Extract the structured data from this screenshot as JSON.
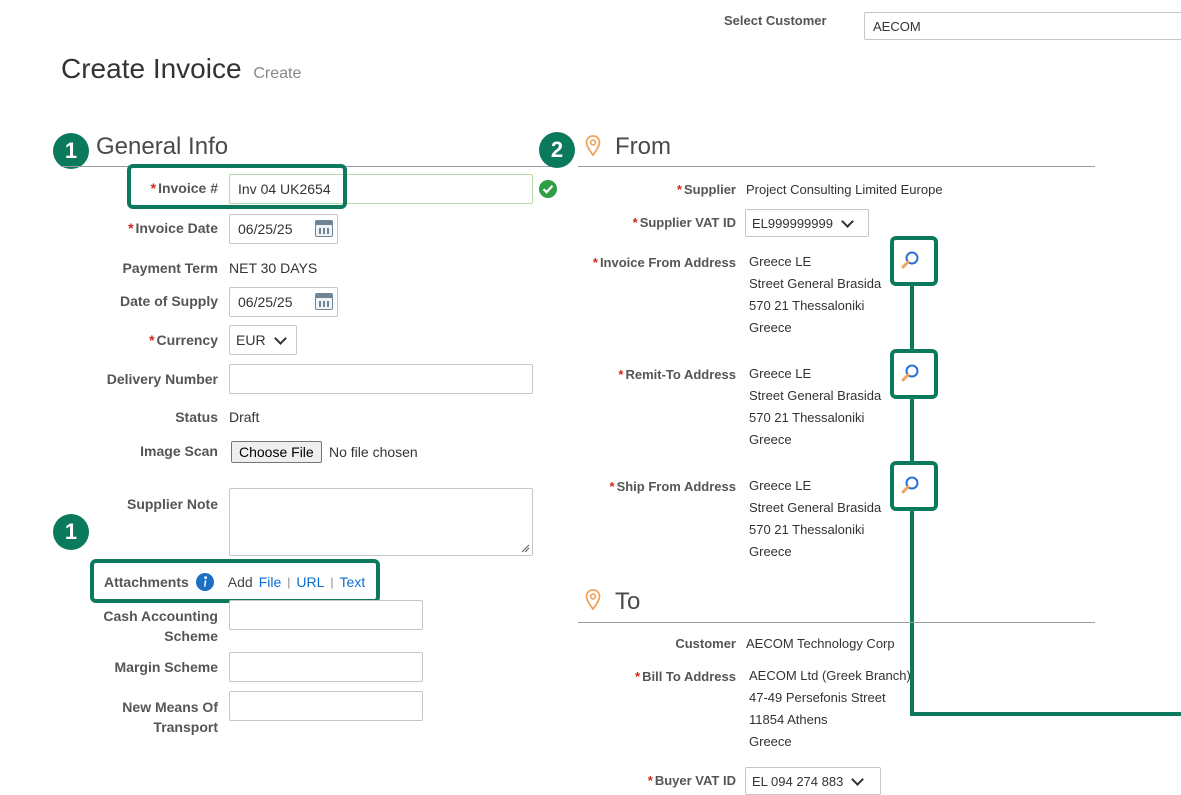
{
  "header": {
    "select_customer_label": "Select Customer",
    "select_customer_value": "AECOM"
  },
  "page": {
    "title": "Create Invoice",
    "subtitle": "Create"
  },
  "general_info": {
    "title": "General Info",
    "invoice_no_label": "Invoice #",
    "invoice_no_value": "Inv 04 UK2654",
    "invoice_date_label": "Invoice Date",
    "invoice_date_value": "06/25/25",
    "payment_term_label": "Payment Term",
    "payment_term_value": "NET 30 DAYS",
    "date_of_supply_label": "Date of Supply",
    "date_of_supply_value": "06/25/25",
    "currency_label": "Currency",
    "currency_value": "EUR",
    "delivery_number_label": "Delivery Number",
    "delivery_number_value": "",
    "status_label": "Status",
    "status_value": "Draft",
    "image_scan_label": "Image Scan",
    "choose_file_label": "Choose File",
    "no_file_text": "No file chosen",
    "supplier_note_label": "Supplier Note",
    "attachments_label": "Attachments",
    "add_text": "Add",
    "file_link": "File",
    "url_link": "URL",
    "text_link": "Text",
    "cash_accounting_label_1": "Cash Accounting",
    "cash_accounting_label_2": "Scheme",
    "margin_scheme_label": "Margin Scheme",
    "new_means_label_1": "New Means Of",
    "new_means_label_2": "Transport"
  },
  "from": {
    "title": "From",
    "supplier_label": "Supplier",
    "supplier_value": "Project Consulting Limited Europe",
    "supplier_vat_label": "Supplier VAT ID",
    "supplier_vat_value": "EL999999999",
    "invoice_from_label": "Invoice From Address",
    "remit_to_label": "Remit-To Address",
    "ship_from_label": "Ship From Address",
    "address": {
      "line1": "Greece LE",
      "line2": "Street General Brasida",
      "line3": "570 21 Thessaloniki",
      "line4": "Greece"
    }
  },
  "to": {
    "title": "To",
    "customer_label": "Customer",
    "customer_value": "AECOM Technology Corp",
    "bill_to_label": "Bill To Address",
    "bill_to": {
      "line1": "AECOM Ltd (Greek Branch)",
      "line2": "47-49 Persefonis Street",
      "line3": "11854 Athens",
      "line4": "Greece"
    },
    "buyer_vat_label": "Buyer VAT ID",
    "buyer_vat_value": "EL 094 274 883"
  },
  "badges": {
    "one": "1",
    "two": "2"
  },
  "colors": {
    "accent": "#0b7a5c",
    "required": "#d0271d",
    "link": "#0a6ed1",
    "pin": "#f0a35a",
    "valid": "#2e9e45"
  }
}
